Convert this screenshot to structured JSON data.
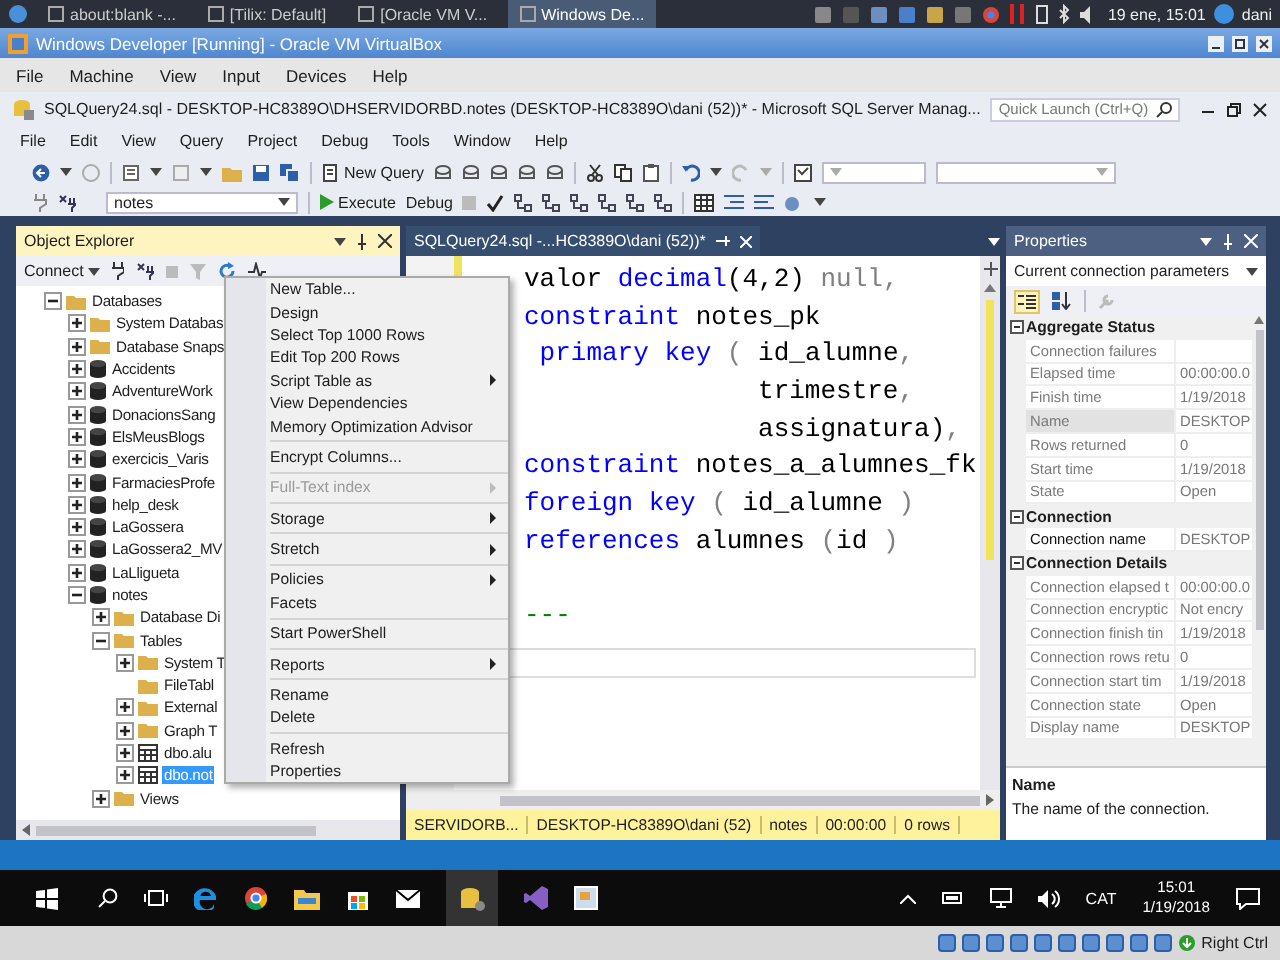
{
  "host_panel": {
    "tasks": [
      {
        "label": "about:blank -...",
        "selected": false
      },
      {
        "label": "[Tilix: Default]",
        "selected": false
      },
      {
        "label": "[Oracle VM V...",
        "selected": false
      },
      {
        "label": "Windows De...",
        "selected": true
      }
    ],
    "clock": "19 ene, 15:01",
    "user": "dani"
  },
  "vbox": {
    "title": "Windows Developer [Running] - Oracle VM VirtualBox",
    "menu": [
      "File",
      "Machine",
      "View",
      "Input",
      "Devices",
      "Help"
    ],
    "status": "Right Ctrl"
  },
  "ssms": {
    "title": "SQLQuery24.sql - DESKTOP-HC8389O\\DHSERVIDORBD.notes (DESKTOP-HC8389O\\dani (52))* - Microsoft SQL Server Manag...",
    "quick_launch": {
      "placeholder": "Quick Launch (Ctrl+Q)"
    },
    "menu": [
      "File",
      "Edit",
      "View",
      "Query",
      "Project",
      "Debug",
      "Tools",
      "Window",
      "Help"
    ],
    "toolbar": {
      "new_query": "New Query",
      "database": "notes",
      "execute": "Execute",
      "debug": "Debug"
    }
  },
  "object_explorer": {
    "title": "Object Explorer",
    "connect": "Connect",
    "tree": [
      {
        "label": "Databases",
        "kind": "folder",
        "expandable": true,
        "expanded": true,
        "selected": false,
        "children": [
          {
            "label": "System Databas",
            "kind": "folder",
            "expandable": true,
            "expanded": false,
            "selected": false
          },
          {
            "label": "Database Snaps",
            "kind": "folder",
            "expandable": true,
            "expanded": false,
            "selected": false
          },
          {
            "label": "Accidents",
            "kind": "database",
            "expandable": true,
            "expanded": false,
            "selected": false
          },
          {
            "label": "AdventureWork",
            "kind": "database",
            "expandable": true,
            "expanded": false,
            "selected": false
          },
          {
            "label": "DonacionsSang",
            "kind": "database",
            "expandable": true,
            "expanded": false,
            "selected": false
          },
          {
            "label": "ElsMeusBlogs",
            "kind": "database",
            "expandable": true,
            "expanded": false,
            "selected": false
          },
          {
            "label": "exercicis_Varis",
            "kind": "database",
            "expandable": true,
            "expanded": false,
            "selected": false
          },
          {
            "label": "FarmaciesProfe",
            "kind": "database",
            "expandable": true,
            "expanded": false,
            "selected": false
          },
          {
            "label": "help_desk",
            "kind": "database",
            "expandable": true,
            "expanded": false,
            "selected": false
          },
          {
            "label": "LaGossera",
            "kind": "database",
            "expandable": true,
            "expanded": false,
            "selected": false
          },
          {
            "label": "LaGossera2_MV",
            "kind": "database",
            "expandable": true,
            "expanded": false,
            "selected": false
          },
          {
            "label": "LaLligueta",
            "kind": "database",
            "expandable": true,
            "expanded": false,
            "selected": false
          },
          {
            "label": "notes",
            "kind": "database",
            "expandable": true,
            "expanded": true,
            "selected": false,
            "children": [
              {
                "label": "Database Di",
                "kind": "folder",
                "expandable": true,
                "expanded": false,
                "selected": false
              },
              {
                "label": "Tables",
                "kind": "folder",
                "expandable": true,
                "expanded": true,
                "selected": false,
                "children": [
                  {
                    "label": "System T",
                    "kind": "folder",
                    "expandable": true,
                    "expanded": false,
                    "selected": false
                  },
                  {
                    "label": "FileTabl",
                    "kind": "folder",
                    "expandable": false,
                    "selected": false
                  },
                  {
                    "label": "External",
                    "kind": "folder",
                    "expandable": true,
                    "expanded": false,
                    "selected": false
                  },
                  {
                    "label": "Graph T",
                    "kind": "folder",
                    "expandable": true,
                    "expanded": false,
                    "selected": false
                  },
                  {
                    "label": "dbo.alu",
                    "kind": "table",
                    "expandable": true,
                    "expanded": false,
                    "selected": false
                  },
                  {
                    "label": "dbo.not",
                    "kind": "table",
                    "expandable": true,
                    "expanded": false,
                    "selected": true
                  }
                ]
              },
              {
                "label": "Views",
                "kind": "folder",
                "expandable": true,
                "expanded": false,
                "selected": false
              }
            ]
          }
        ]
      }
    ]
  },
  "editor": {
    "tab": "SQLQuery24.sql -...HC8389O\\dani (52))*",
    "lines": [
      {
        "tokens": [
          {
            "kind": "plain",
            "text": "valor "
          },
          {
            "kind": "keyword",
            "text": "decimal"
          },
          {
            "kind": "plain",
            "text": "(4,2) "
          },
          {
            "kind": "gray",
            "text": "null,"
          }
        ],
        "blank_before": false
      },
      {
        "tokens": [
          {
            "kind": "keyword",
            "text": "constraint"
          },
          {
            "kind": "plain",
            "text": " notes_pk"
          }
        ],
        "blank_before": false
      },
      {
        "tokens": [
          {
            "kind": "keyword",
            "text": " primary key"
          },
          {
            "kind": "gray",
            "text": " ("
          },
          {
            "kind": "plain",
            "text": " id_alumne"
          },
          {
            "kind": "gray",
            "text": ","
          }
        ],
        "blank_before": false
      },
      {
        "tokens": [
          {
            "kind": "plain",
            "text": "               trimestre"
          },
          {
            "kind": "gray",
            "text": ","
          }
        ],
        "blank_before": false
      },
      {
        "tokens": [
          {
            "kind": "plain",
            "text": "               assignatura)"
          },
          {
            "kind": "gray",
            "text": ","
          }
        ],
        "blank_before": false
      },
      {
        "tokens": [
          {
            "kind": "keyword",
            "text": "constraint"
          },
          {
            "kind": "plain",
            "text": " notes_a_alumnes_fk"
          }
        ],
        "blank_before": false
      },
      {
        "tokens": [
          {
            "kind": "keyword",
            "text": "foreign key"
          },
          {
            "kind": "gray",
            "text": " ("
          },
          {
            "kind": "plain",
            "text": " id_alumne "
          },
          {
            "kind": "gray",
            "text": ")"
          }
        ],
        "blank_before": false
      },
      {
        "tokens": [
          {
            "kind": "keyword",
            "text": "references"
          },
          {
            "kind": "plain",
            "text": " alumnes "
          },
          {
            "kind": "gray",
            "text": "("
          },
          {
            "kind": "plain",
            "text": "id "
          },
          {
            "kind": "gray",
            "text": ")"
          }
        ],
        "blank_before": false
      },
      {
        "tokens": [
          {
            "kind": "comment",
            "text": "---"
          }
        ],
        "blank_before": true
      }
    ],
    "status": [
      "SERVIDORB...",
      "DESKTOP-HC8389O\\dani (52)",
      "notes",
      "00:00:00",
      "0 rows"
    ]
  },
  "properties": {
    "title": "Properties",
    "object": "Current connection parameters",
    "categories": [
      {
        "name": "Aggregate Status",
        "expanded": true,
        "rows": [
          {
            "name": "Connection failures",
            "readonly": true,
            "selected": false
          },
          {
            "name": "Elapsed time",
            "value": "00:00:00.0",
            "readonly": true,
            "selected": false
          },
          {
            "name": "Finish time",
            "value": "1/19/2018",
            "readonly": true,
            "selected": false
          },
          {
            "name": "Name",
            "value": "DESKTOP",
            "readonly": true,
            "selected": true
          },
          {
            "name": "Rows returned",
            "value": "0",
            "readonly": true,
            "selected": false
          },
          {
            "name": "Start time",
            "value": "1/19/2018",
            "readonly": true,
            "selected": false
          },
          {
            "name": "State",
            "value": "Open",
            "readonly": true,
            "selected": false
          }
        ]
      },
      {
        "name": "Connection",
        "expanded": true,
        "rows": [
          {
            "name": "Connection name",
            "value": "DESKTOP",
            "readonly": false,
            "selected": false
          }
        ]
      },
      {
        "name": "Connection Details",
        "expanded": true,
        "rows": [
          {
            "name": "Connection elapsed t",
            "value": "00:00:00.0",
            "readonly": true,
            "selected": false
          },
          {
            "name": "Connection encryptic",
            "value": "Not encry",
            "readonly": true,
            "selected": false
          },
          {
            "name": "Connection finish tin",
            "value": "1/19/2018",
            "readonly": true,
            "selected": false
          },
          {
            "name": "Connection rows retu",
            "value": "0",
            "readonly": true,
            "selected": false
          },
          {
            "name": "Connection start tim",
            "value": "1/19/2018",
            "readonly": true,
            "selected": false
          },
          {
            "name": "Connection state",
            "value": "Open",
            "readonly": true,
            "selected": false
          },
          {
            "name": "Display name",
            "value": "DESKTOP",
            "readonly": true,
            "selected": false
          }
        ]
      }
    ],
    "description_title": "Name",
    "description": "The name of the connection."
  },
  "context_menu": {
    "groups": [
      [
        {
          "label": "New Table...",
          "submenu": false,
          "disabled": false
        },
        {
          "label": "Design",
          "submenu": false,
          "disabled": false
        },
        {
          "label": "Select Top 1000 Rows",
          "submenu": false,
          "disabled": false
        },
        {
          "label": "Edit Top 200 Rows",
          "submenu": false,
          "disabled": false
        },
        {
          "label": "Script Table as",
          "submenu": true,
          "disabled": false
        },
        {
          "label": "View Dependencies",
          "submenu": false,
          "disabled": false
        },
        {
          "label": "Memory Optimization Advisor",
          "submenu": false,
          "disabled": false
        }
      ],
      [
        {
          "label": "Encrypt Columns...",
          "submenu": false,
          "disabled": false
        }
      ],
      [
        {
          "label": "Full-Text index",
          "submenu": true,
          "disabled": true
        }
      ],
      [
        {
          "label": "Storage",
          "submenu": true,
          "disabled": false
        }
      ],
      [
        {
          "label": "Stretch",
          "submenu": true,
          "disabled": false
        }
      ],
      [
        {
          "label": "Policies",
          "submenu": true,
          "disabled": false
        },
        {
          "label": "Facets",
          "submenu": false,
          "disabled": false
        }
      ],
      [
        {
          "label": "Start PowerShell",
          "submenu": false,
          "disabled": false
        }
      ],
      [
        {
          "label": "Reports",
          "submenu": true,
          "disabled": false
        }
      ],
      [
        {
          "label": "Rename",
          "submenu": false,
          "disabled": false
        },
        {
          "label": "Delete",
          "submenu": false,
          "disabled": false
        }
      ],
      [
        {
          "label": "Refresh",
          "submenu": false,
          "disabled": false
        },
        {
          "label": "Properties",
          "submenu": false,
          "disabled": false
        }
      ]
    ]
  },
  "taskbar": {
    "language": "CAT",
    "time": "15:01",
    "date": "1/19/2018"
  }
}
